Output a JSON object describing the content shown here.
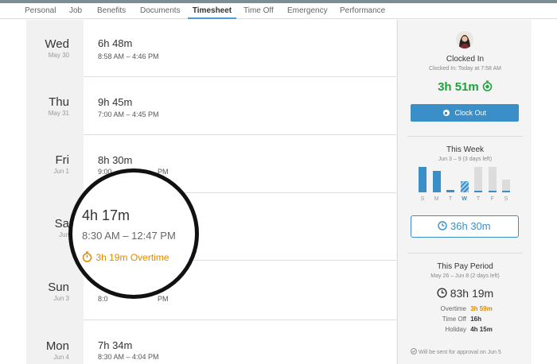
{
  "tabs": [
    "Personal",
    "Job",
    "Benefits",
    "Documents",
    "Timesheet",
    "Time Off",
    "Emergency",
    "Performance"
  ],
  "active_tab": "Timesheet",
  "days": [
    {
      "name": "Wed",
      "date": "May 30",
      "hours": "6h 48m",
      "range": "8:58 AM – 4:46 PM"
    },
    {
      "name": "Thu",
      "date": "May 31",
      "hours": "9h 45m",
      "range": "7:00 AM – 4:45 PM"
    },
    {
      "name": "Fri",
      "date": "Jun 1",
      "hours": "8h 30m",
      "range": "9:00"
    },
    {
      "name": "Sa",
      "date": "Jun",
      "hours": "",
      "range": ""
    },
    {
      "name": "Sun",
      "date": "Jun 3",
      "hours": "",
      "range": "8:0"
    },
    {
      "name": "Mon",
      "date": "Jun 4",
      "hours": "7h 34m",
      "range": "8:30 AM – 4:04 PM"
    }
  ],
  "peek": {
    "fri_range_tail": "PM",
    "sun_range_tail": "PM"
  },
  "magnifier": {
    "hours": "4h 17m",
    "range": "8:30 AM – 12:47 PM",
    "overtime": "3h 19m Overtime"
  },
  "sidebar": {
    "status_title": "Clocked In",
    "status_sub": "Clocked In: Today at 7:58 AM",
    "elapsed": "3h 51m",
    "clock_out_label": "Clock Out",
    "week_title": "This Week",
    "week_sub": "Jun 3 – 9 (3 days left)",
    "week_bars": [
      {
        "day": "S",
        "level": 0.9,
        "style": "filled"
      },
      {
        "day": "M",
        "level": 0.75,
        "style": "filled"
      },
      {
        "day": "T",
        "level": 0.08,
        "style": "filled"
      },
      {
        "day": "W",
        "level": 0.4,
        "style": "today"
      },
      {
        "day": "T",
        "level": 0.9,
        "style": "future"
      },
      {
        "day": "F",
        "level": 0.9,
        "style": "future"
      },
      {
        "day": "S",
        "level": 0.45,
        "style": "future"
      }
    ],
    "week_total": "36h 30m",
    "period_title": "This Pay Period",
    "period_sub": "May 26 – Jun 8 (2 days left)",
    "period_total": "83h 19m",
    "stats": [
      {
        "label": "Overtime",
        "value": "3h 59m"
      },
      {
        "label": "Time Off",
        "value": "16h"
      },
      {
        "label": "Holiday",
        "value": "4h 15m"
      }
    ],
    "approval_note": "Will be sent for approval on Jun 5"
  },
  "colors": {
    "accent": "#3a8fc8",
    "green": "#1ea23a",
    "overtime": "#e08a00",
    "future_bar": "#dcdcdc"
  }
}
